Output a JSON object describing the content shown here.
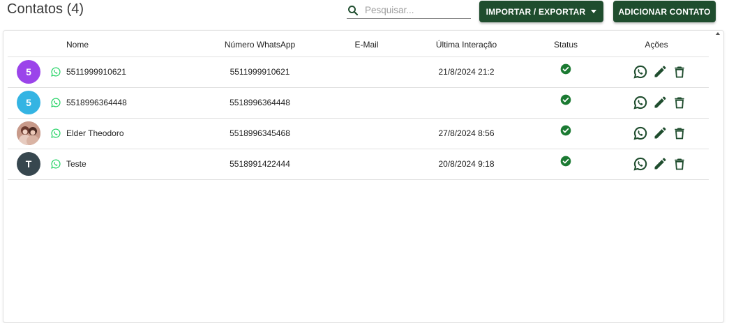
{
  "header": {
    "title": "Contatos (4)",
    "search_placeholder": "Pesquisar...",
    "import_export_label": "IMPORTAR / EXPORTAR",
    "add_contact_label": "ADICIONAR CONTATO"
  },
  "colors": {
    "primary": "#1f4d2e",
    "whatsapp_green": "#25d366",
    "status_green": "#1b7a32"
  },
  "table": {
    "columns": {
      "name": "Nome",
      "number": "Número WhatsApp",
      "email": "E-Mail",
      "last_interaction": "Última Interação",
      "status": "Status",
      "actions": "Ações"
    },
    "rows": [
      {
        "avatar_letter": "5",
        "avatar_color": "#9b44ea",
        "name": "5511999910621",
        "number": "5511999910621",
        "email": "",
        "last_interaction": "21/8/2024 21:2",
        "status_icon": "check-circle-icon"
      },
      {
        "avatar_letter": "5",
        "avatar_color": "#34b4e3",
        "name": "5518996364448",
        "number": "5518996364448",
        "email": "",
        "last_interaction": "",
        "status_icon": "check-circle-icon"
      },
      {
        "avatar_letter": "",
        "avatar_color": "#b07a6a",
        "avatar_photo": true,
        "name": "Elder Theodoro",
        "number": "5518996345468",
        "email": "",
        "last_interaction": "27/8/2024 8:56",
        "status_icon": "check-circle-icon"
      },
      {
        "avatar_letter": "T",
        "avatar_color": "#37474f",
        "name": "Teste",
        "number": "5518991422444",
        "email": "",
        "last_interaction": "20/8/2024 9:18",
        "status_icon": "check-circle-icon"
      }
    ]
  }
}
